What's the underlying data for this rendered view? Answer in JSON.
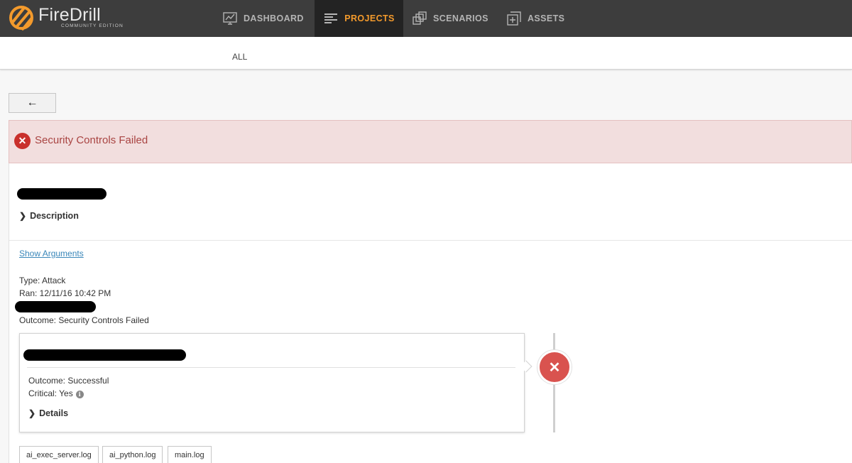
{
  "app": {
    "logo_text": "FireDrill",
    "logo_subtitle": "COMMUNITY EDITION",
    "brand_color": "#f39a2c"
  },
  "nav": {
    "items": [
      {
        "label": "DASHBOARD",
        "icon": "chart-monitor-icon",
        "active": false
      },
      {
        "label": "PROJECTS",
        "icon": "list-lines-icon",
        "active": true
      },
      {
        "label": "SCENARIOS",
        "icon": "stacked-squares-icon",
        "active": false
      },
      {
        "label": "ASSETS",
        "icon": "plus-square-icon",
        "active": false
      }
    ]
  },
  "subnav": {
    "all_label": "ALL"
  },
  "back_button": {
    "label": "←"
  },
  "banner": {
    "icon": "error-x-icon",
    "text": "Security Controls Failed",
    "color": "#a94442"
  },
  "detail": {
    "description_label": "Description",
    "show_arguments_label": "Show Arguments",
    "type": "Type: Attack",
    "ran": "Ran: 12/11/16 10:42 PM",
    "outcome": "Outcome: Security Controls Failed"
  },
  "action_card": {
    "outcome": "Outcome: Successful",
    "critical": "Critical: Yes",
    "info_glyph": "i",
    "details_label": "Details",
    "status_icon": "failed-x-icon",
    "status_color": "#d9534f"
  },
  "logs": [
    {
      "label": "ai_exec_server.log"
    },
    {
      "label": "ai_python.log"
    },
    {
      "label": "main.log"
    }
  ]
}
